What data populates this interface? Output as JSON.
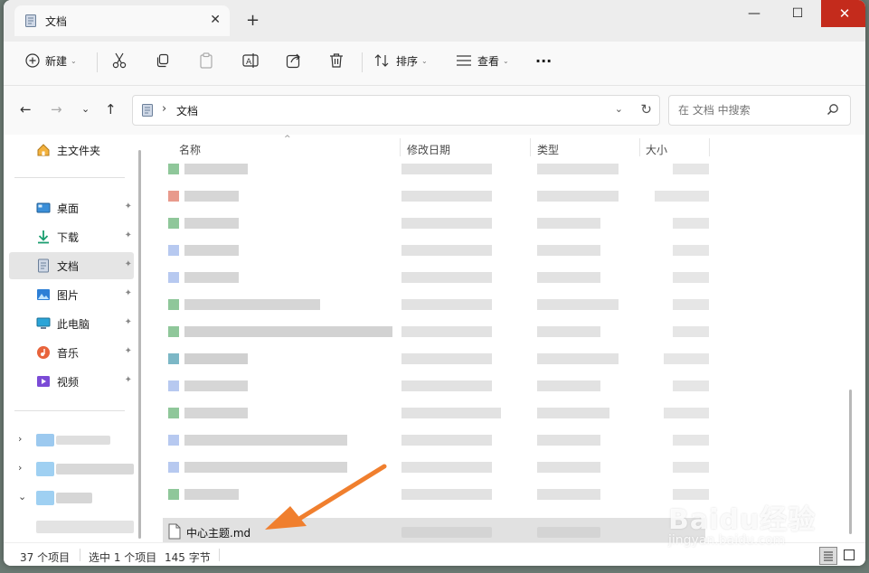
{
  "titlebar": {
    "tab_label": "文档",
    "close_tab": "✕",
    "new_tab": "+",
    "minimize": "—",
    "maximize": "☐",
    "close_window": "✕"
  },
  "toolbar": {
    "new_label": "新建",
    "sort_label": "排序",
    "view_label": "查看",
    "more_label": "···",
    "caret": "⌄"
  },
  "address": {
    "folder": "文档",
    "chevron": "›",
    "down": "⌄",
    "refresh": "↻"
  },
  "search": {
    "placeholder": "在 文档 中搜索"
  },
  "nav": {
    "back": "←",
    "forward": "→",
    "recent": "⌄",
    "up": "↑"
  },
  "sidebar": {
    "home": "主文件夹",
    "items": [
      {
        "label": "桌面",
        "icon": "desktop-icon"
      },
      {
        "label": "下载",
        "icon": "download-icon"
      },
      {
        "label": "文档",
        "icon": "document-icon"
      },
      {
        "label": "图片",
        "icon": "pictures-icon"
      },
      {
        "label": "此电脑",
        "icon": "computer-icon"
      },
      {
        "label": "音乐",
        "icon": "music-icon"
      },
      {
        "label": "视频",
        "icon": "video-icon"
      }
    ],
    "pin": "📌",
    "tree_chevrons": [
      "›",
      "›",
      "⌄"
    ]
  },
  "columns": {
    "name": "名称",
    "modified": "修改日期",
    "type": "类型",
    "size": "大小",
    "sort_indicator": "^"
  },
  "files": {
    "selected_name": "中心主题.md"
  },
  "status": {
    "count": "37 个项目",
    "selection": "选中 1 个项目",
    "size": "145 字节"
  },
  "watermark": {
    "main": "Baidu经验",
    "sub": "jingyan.baidu.com"
  },
  "colors": {
    "accent": "#0067c0",
    "close_red": "#c42b1c",
    "arrow_orange": "#f07f2e",
    "selection": "#e5e5e5"
  }
}
